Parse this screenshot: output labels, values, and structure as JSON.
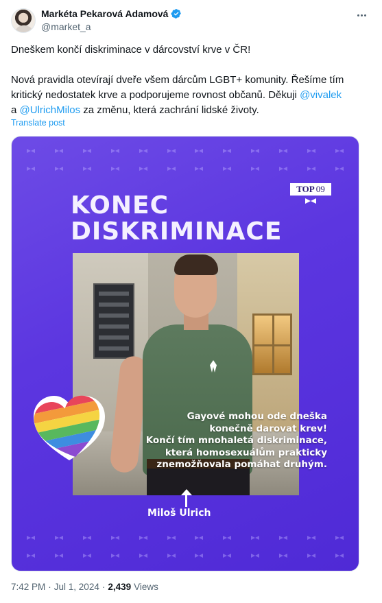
{
  "author": {
    "display_name": "Markéta Pekarová Adamová",
    "handle": "@market_a",
    "verified": true
  },
  "post": {
    "line1": "Dneškem končí diskriminace v dárcovství krve v ČR!",
    "para2_part1": "Nová pravidla otevírají dveře všem dárcům LGBT+ komunity. Řešíme tím kritický nedostatek krve a podporujeme rovnost občanů. Děkuji ",
    "mention1": "@vivalek",
    "para2_part2": "a ",
    "mention2": "@UlrichMilos",
    "para2_part3": " za změnu, která zachrání lidské životy.",
    "translate_label": "Translate post"
  },
  "image": {
    "headline_line1": "KONEC",
    "headline_line2": "DISKRIMINACE",
    "logo_word": "TOP",
    "logo_number": "09",
    "caption_lines": [
      "Gayové mohou ode dneška",
      "konečně darovat krev!",
      "Končí tím mnohaletá diskriminace,",
      "která homosexuálům prakticky",
      "znemožňovala pomáhat druhým."
    ],
    "person_label": "Miloš Ulrich",
    "colors": {
      "background": "#5c36e0",
      "text": "#ffffff"
    }
  },
  "footer": {
    "time": "7:42 PM",
    "separator": "·",
    "date": "Jul 1, 2024",
    "separator2": "·",
    "views_count": "2,439",
    "views_label": "Views"
  },
  "icons": [
    "verified-badge-icon",
    "more-options-icon",
    "rainbow-heart-icon",
    "up-arrow-icon"
  ]
}
